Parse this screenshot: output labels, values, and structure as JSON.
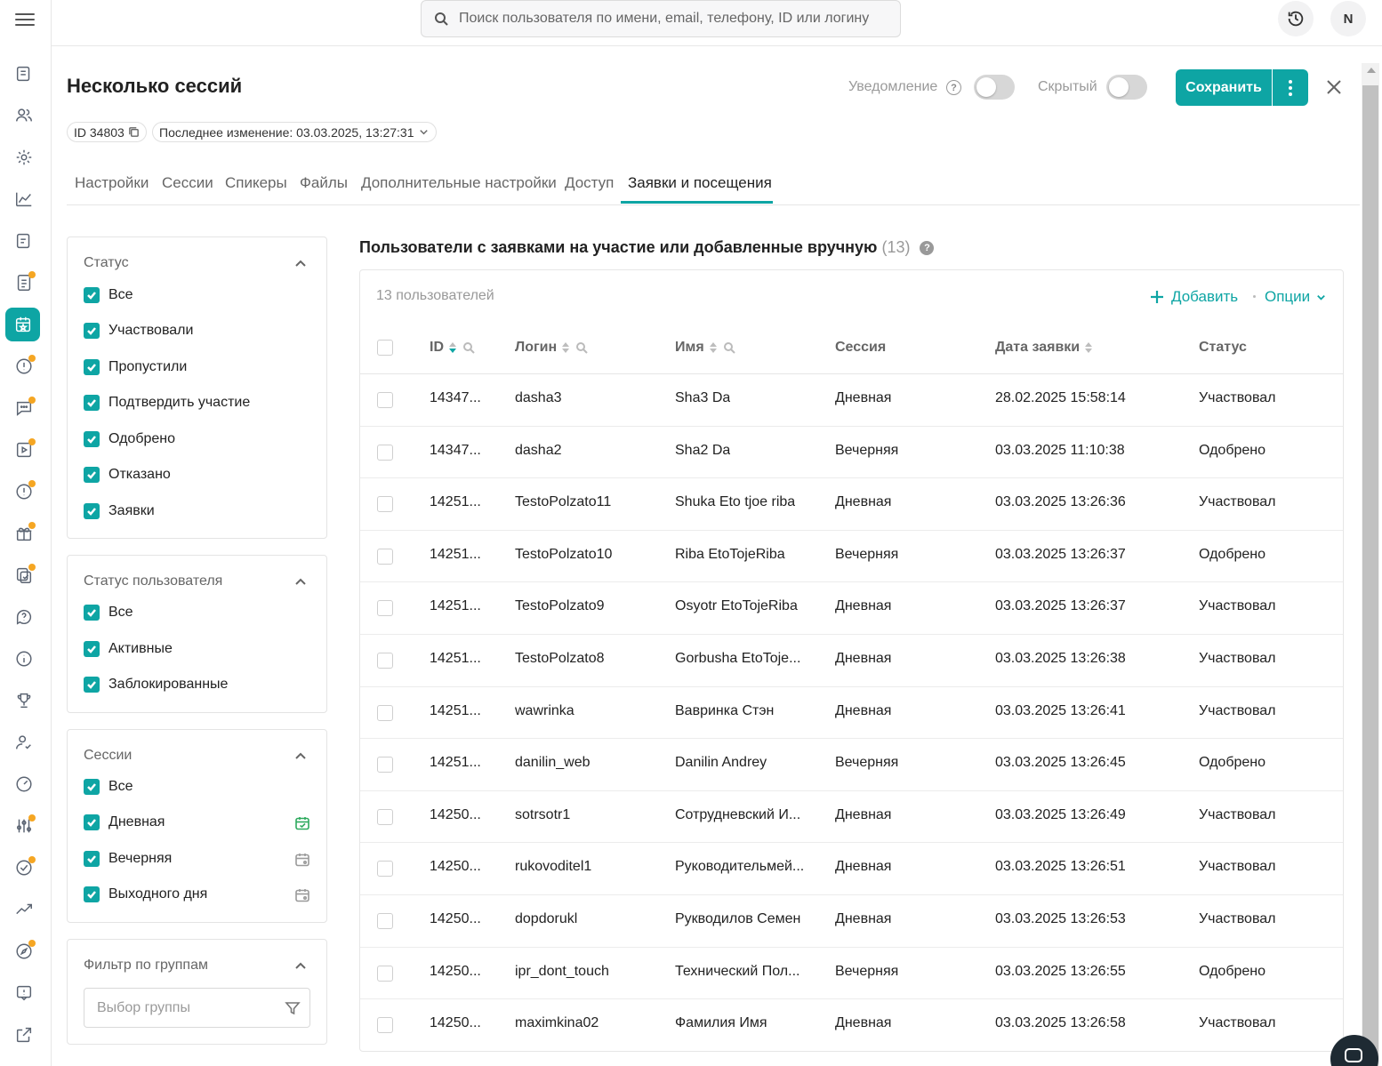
{
  "search": {
    "placeholder": "Поиск пользователя по имени, email, телефону, ID или логину"
  },
  "user": {
    "avatar_letter": "N"
  },
  "header": {
    "title": "Несколько сессий",
    "notification_label": "Уведомление",
    "hidden_label": "Скрытый",
    "save_label": "Сохранить",
    "id_chip": "ID 34803",
    "last_change": "Последнее изменение: 03.03.2025, 13:27:31"
  },
  "tabs": [
    {
      "label": "Настройки"
    },
    {
      "label": "Сессии"
    },
    {
      "label": "Спикеры"
    },
    {
      "label": "Файлы"
    },
    {
      "label": "Дополнительные настройки"
    },
    {
      "label": "Доступ"
    },
    {
      "label": "Заявки и посещения"
    }
  ],
  "filters": {
    "status": {
      "title": "Статус",
      "items": [
        "Все",
        "Участвовали",
        "Пропустили",
        "Подтвердить участие",
        "Одобрено",
        "Отказано",
        "Заявки"
      ]
    },
    "user_status": {
      "title": "Статус пользователя",
      "items": [
        "Все",
        "Активные",
        "Заблокированные"
      ]
    },
    "sessions": {
      "title": "Сессии",
      "items": [
        "Все",
        "Дневная",
        "Вечерняя",
        "Выходного дня"
      ]
    },
    "groups": {
      "title": "Фильтр по группам",
      "placeholder": "Выбор группы"
    }
  },
  "main": {
    "section_title": "Пользователи с заявками на участие или добавленные вручную",
    "section_count": "(13)",
    "users_count": "13 пользователей",
    "add_label": "Добавить",
    "options_label": "Опции",
    "columns": [
      "ID",
      "Логин",
      "Имя",
      "Сессия",
      "Дата заявки",
      "Статус"
    ],
    "rows": [
      [
        "14347...",
        "dasha3",
        "Sha3 Da",
        "Дневная",
        "28.02.2025 15:58:14",
        "Участвовал"
      ],
      [
        "14347...",
        "dasha2",
        "Sha2 Da",
        "Вечерняя",
        "03.03.2025 11:10:38",
        "Одобрено"
      ],
      [
        "14251...",
        "TestoPolzato11",
        "Shuka Eto tjoe riba",
        "Дневная",
        "03.03.2025 13:26:36",
        "Участвовал"
      ],
      [
        "14251...",
        "TestoPolzato10",
        "Riba EtoTojeRiba",
        "Вечерняя",
        "03.03.2025 13:26:37",
        "Одобрено"
      ],
      [
        "14251...",
        "TestoPolzato9",
        "Osyotr EtoTojeRiba",
        "Дневная",
        "03.03.2025 13:26:37",
        "Участвовал"
      ],
      [
        "14251...",
        "TestoPolzato8",
        "Gorbusha EtoToje...",
        "Дневная",
        "03.03.2025 13:26:38",
        "Участвовал"
      ],
      [
        "14251...",
        "wawrinka",
        "Вавринка Стэн",
        "Дневная",
        "03.03.2025 13:26:41",
        "Участвовал"
      ],
      [
        "14251...",
        "danilin_web",
        "Danilin Andrey",
        "Вечерняя",
        "03.03.2025 13:26:45",
        "Одобрено"
      ],
      [
        "14250...",
        "sotrsotr1",
        "Сотрудневский И...",
        "Дневная",
        "03.03.2025 13:26:49",
        "Участвовал"
      ],
      [
        "14250...",
        "rukovoditel1",
        "Руководительмей...",
        "Дневная",
        "03.03.2025 13:26:51",
        "Участвовал"
      ],
      [
        "14250...",
        "dopdorukl",
        "Рукводилов Семен",
        "Дневная",
        "03.03.2025 13:26:53",
        "Участвовал"
      ],
      [
        "14250...",
        "ipr_dont_touch",
        "Технический Пол...",
        "Вечерняя",
        "03.03.2025 13:26:55",
        "Одобрено"
      ],
      [
        "14250...",
        "maximkina02",
        "Фамилия Имя",
        "Дневная",
        "03.03.2025 13:26:58",
        "Участвовал"
      ]
    ]
  },
  "colors": {
    "accent": "#0ea5a4",
    "badge_dot": "#f5a623",
    "session_active": "#2eaa5e"
  }
}
